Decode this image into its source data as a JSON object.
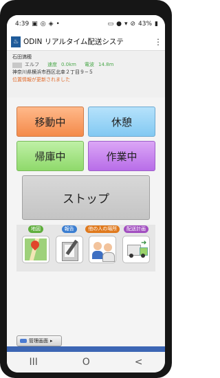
{
  "status_bar": {
    "time": "4:39",
    "battery": "43%",
    "left_icons": [
      "message-icon",
      "ring-icon",
      "cast-icon",
      "dot"
    ],
    "right_icons": [
      "lock-icon",
      "location-icon",
      "wifi-icon",
      "block-icon"
    ]
  },
  "app_bar": {
    "title": "ODIN リアルタイム配送システ",
    "menu": "⋮"
  },
  "info": {
    "driver": "石田満穂",
    "vehicle": "エルフ",
    "speed_label": "速度",
    "speed_value": "0.0km",
    "power_label": "電波",
    "power_value": "14.8m",
    "address": "神奈川県横浜市西区北幸２丁目９−５",
    "notice": "位置情報が更新されました"
  },
  "buttons": {
    "move": "移動中",
    "break": "休憩",
    "return": "帰庫中",
    "work": "作業中",
    "stop": "ストップ"
  },
  "tiles": {
    "map": "地図",
    "report": "報告",
    "others_location": "他の人の場所",
    "delivery_plan": "配送計画"
  },
  "admin": {
    "label": "管理画面"
  },
  "nav": {
    "recents": "III",
    "home": "O",
    "back": "<"
  }
}
